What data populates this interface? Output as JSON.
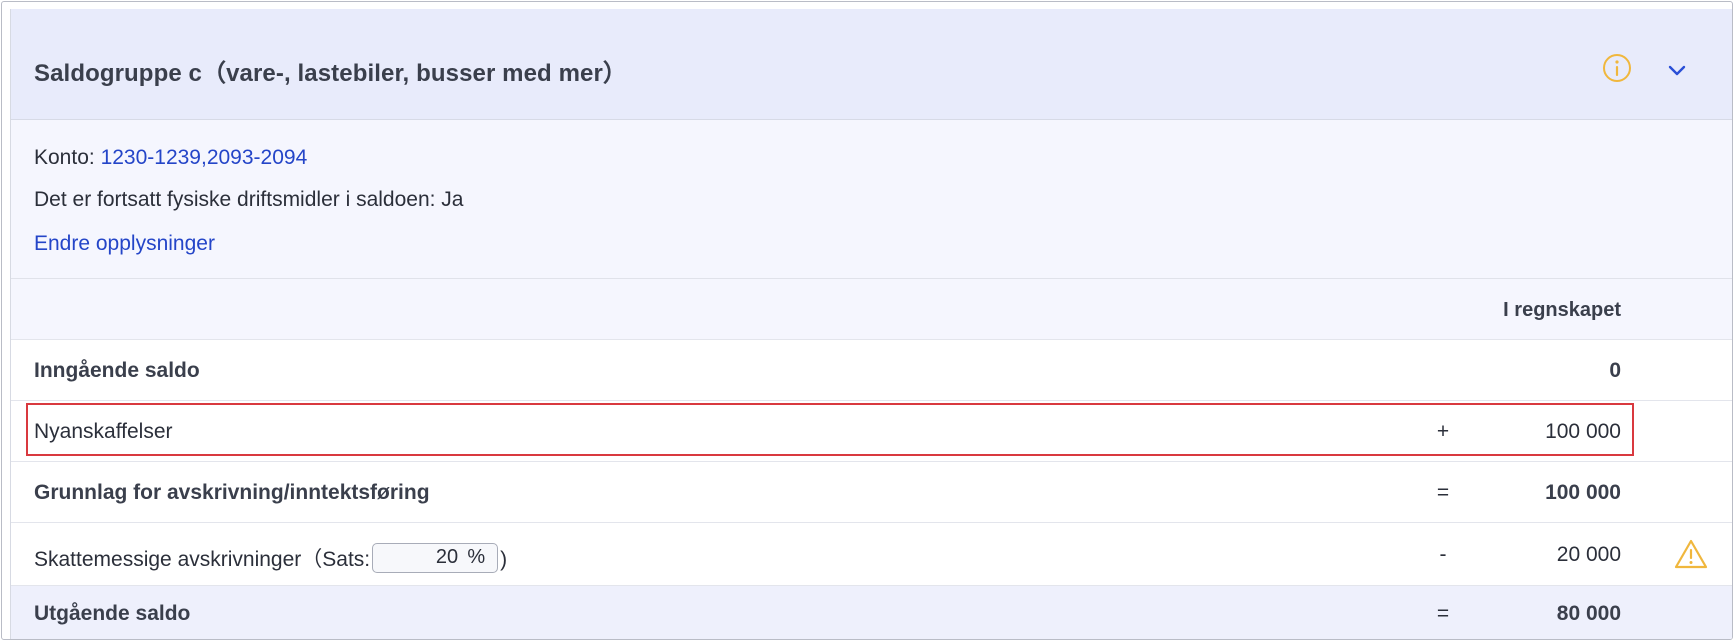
{
  "section": {
    "title": "Saldogruppe c（vare-, lastebiler, busser med mer）",
    "info_icon": "info-circle-icon",
    "collapse_icon": "chevron-down-icon"
  },
  "details": {
    "konto_label": "Konto: ",
    "konto_value": "1230-1239,2093-2094",
    "fysiske_text": "Det er fortsatt fysiske driftsmidler i saldoen: Ja",
    "endre_link": "Endre opplysninger"
  },
  "table": {
    "column_header": "I regnskapet",
    "rows": [
      {
        "label": "Inngående saldo",
        "op": "",
        "value": "0",
        "bold": true
      },
      {
        "label": "Nyanskaffelser",
        "op": "+",
        "value": "100 000",
        "bold": false,
        "highlighted": true
      },
      {
        "label": "Grunnlag for avskrivning/inntektsføring",
        "op": "=",
        "value": "100 000",
        "bold": true
      },
      {
        "label_prefix": "Skattemessige avskrivninger（Sats:",
        "label_suffix": ")",
        "rate": "20",
        "rate_unit": "%",
        "op": "-",
        "value": "20 000",
        "bold": false,
        "warning_icon": "warning-triangle-icon"
      },
      {
        "label": "Utgående saldo",
        "op": "=",
        "value": "80 000",
        "bold": true
      }
    ]
  },
  "colors": {
    "header_bg": "#e8ebfb",
    "link": "#2445c8",
    "info_icon": "#f0b73d",
    "warning_icon": "#f0b73d",
    "chevron": "#2a4fd6",
    "highlight_border": "#d9393f"
  }
}
